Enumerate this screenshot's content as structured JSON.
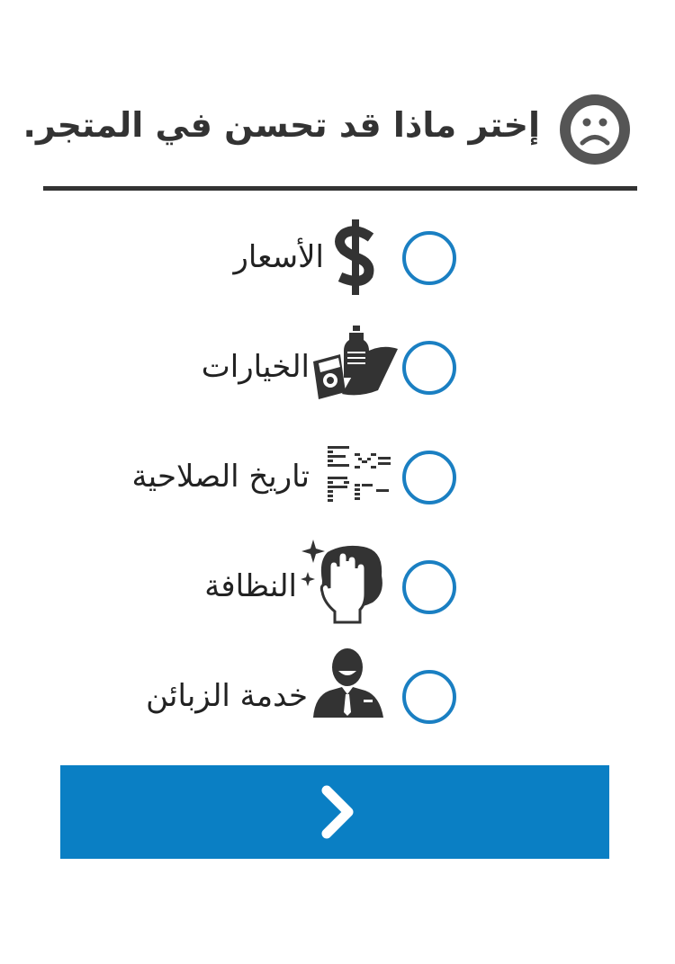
{
  "header": {
    "title": "إختر ماذا قد تحسن في المتجر.",
    "icon": "sad-face-icon"
  },
  "options": [
    {
      "label": "الأسعار",
      "icon": "dollar-icon"
    },
    {
      "label": "الخيارات",
      "icon": "groceries-icon"
    },
    {
      "label": "تاريخ الصلاحية",
      "icon": "expiry-date-icon"
    },
    {
      "label": "النظافة",
      "icon": "cleaning-hand-icon"
    },
    {
      "label": "خدمة الزبائن",
      "icon": "customer-service-icon"
    }
  ],
  "next_button": {
    "icon": "chevron-right-icon"
  },
  "colors": {
    "accent": "#0a7fc4",
    "radio_border": "#1a7fc2",
    "text": "#333333"
  }
}
